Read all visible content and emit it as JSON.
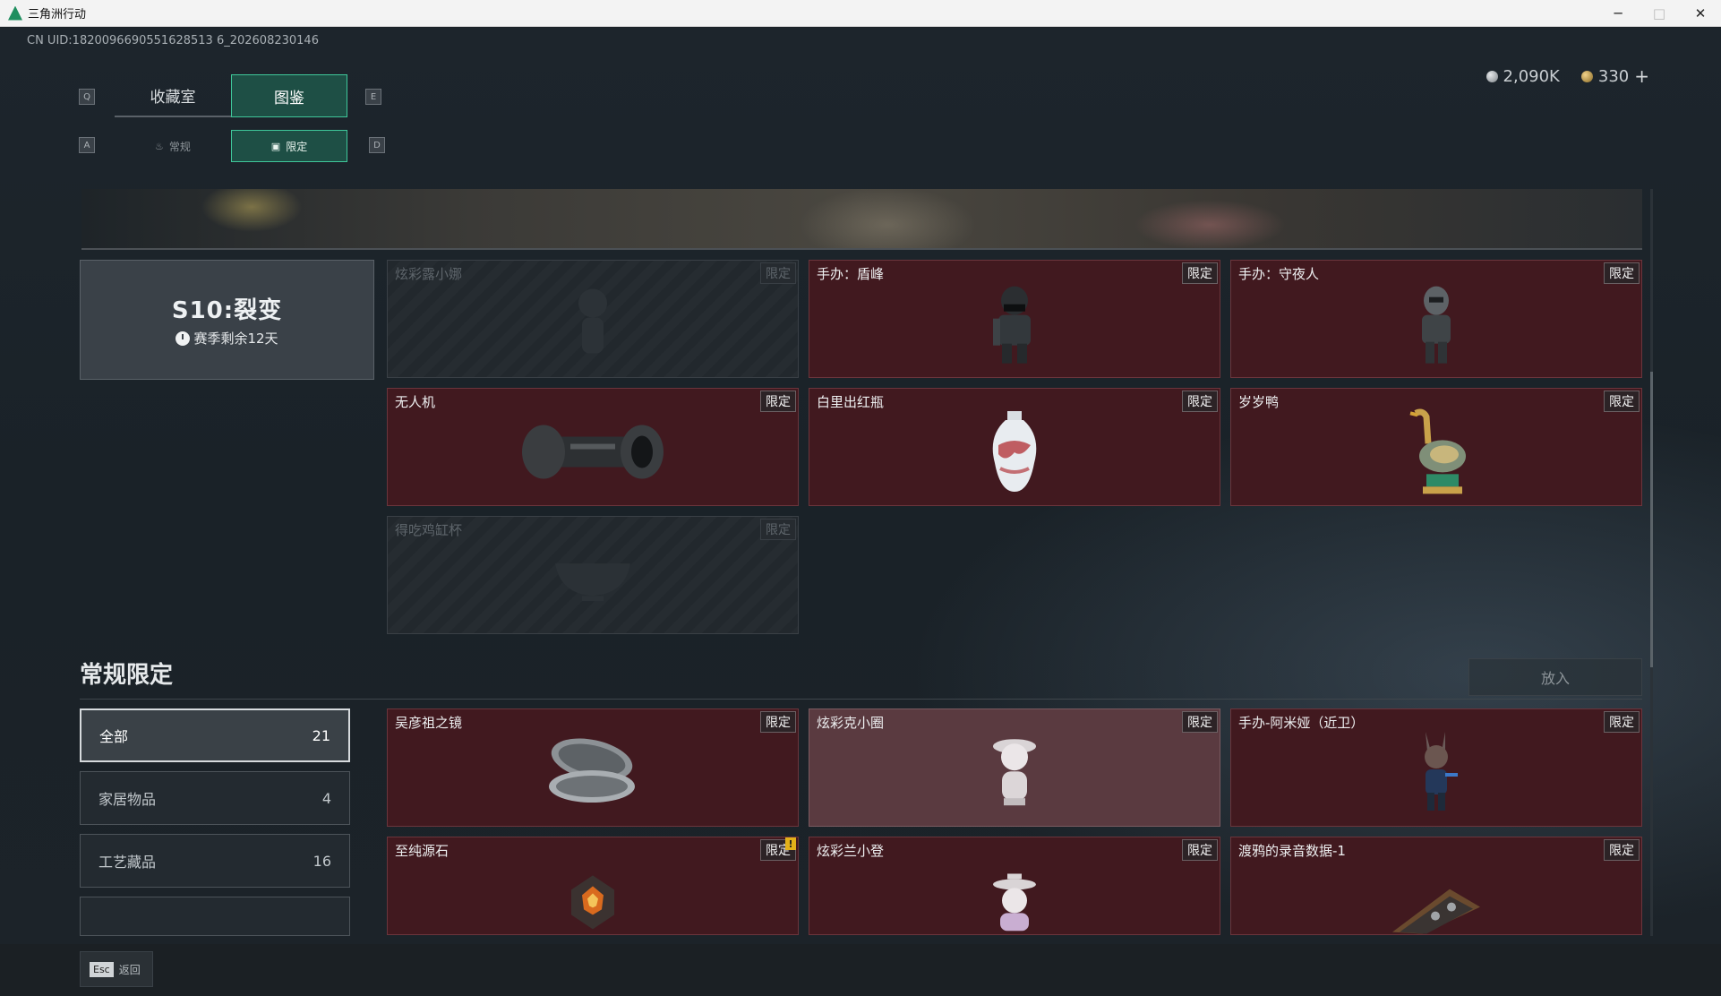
{
  "window": {
    "title": "三角洲行动",
    "controls": {
      "minimize": "─",
      "maximize": "□",
      "close": "✕"
    }
  },
  "uid": "CN UID:1820096690551628513 6_202608230146",
  "currency": [
    {
      "icon": "silver-coin-icon",
      "value": "2,090K"
    },
    {
      "icon": "gold-coin-icon",
      "value": "330"
    }
  ],
  "currency_plus": "+",
  "tabs": {
    "prev_key": "Q",
    "next_key": "E",
    "items": [
      {
        "label": "收藏室",
        "active": false
      },
      {
        "label": "图鉴",
        "active": true
      }
    ]
  },
  "subtabs": {
    "prev_key": "A",
    "next_key": "D",
    "items": [
      {
        "label": "常规",
        "icon": "flame-icon",
        "active": false
      },
      {
        "label": "限定",
        "icon": "image-icon",
        "active": true
      }
    ]
  },
  "season": {
    "title": "S10:裂变",
    "remaining": "赛季剩余12天"
  },
  "season_items": [
    {
      "name": "炫彩露小娜",
      "badge": "限定",
      "state": "locked",
      "icon": "figurine-icon"
    },
    {
      "name": "手办：盾峰",
      "badge": "限定",
      "state": "owned",
      "icon": "soldier-figure-icon"
    },
    {
      "name": "手办：守夜人",
      "badge": "限定",
      "state": "owned",
      "icon": "armored-figure-icon"
    },
    {
      "name": "无人机",
      "badge": "限定",
      "state": "owned",
      "icon": "drone-part-icon"
    },
    {
      "name": "白里出红瓶",
      "badge": "限定",
      "state": "owned",
      "icon": "vase-icon"
    },
    {
      "name": "岁岁鸭",
      "badge": "限定",
      "state": "owned",
      "icon": "duck-statue-icon"
    },
    {
      "name": "得吃鸡缸杯",
      "badge": "限定",
      "state": "locked",
      "icon": "bowl-icon"
    }
  ],
  "section": {
    "title": "常规限定",
    "put_button": "放入"
  },
  "filters": [
    {
      "label": "全部",
      "count": "21",
      "active": true
    },
    {
      "label": "家居物品",
      "count": "4",
      "active": false
    },
    {
      "label": "工艺藏品",
      "count": "16",
      "active": false
    }
  ],
  "regular_items": [
    {
      "name": "吴彦祖之镜",
      "badge": "限定",
      "state": "owned",
      "icon": "mirror-icon"
    },
    {
      "name": "炫彩克小圈",
      "badge": "限定",
      "state": "highlight",
      "icon": "figurine-icon"
    },
    {
      "name": "手办-阿米娅（近卫）",
      "badge": "限定",
      "state": "owned",
      "icon": "anime-figure-icon"
    },
    {
      "name": "至纯源石",
      "badge": "限定",
      "state": "owned",
      "icon": "crystal-icon",
      "warn": "!"
    },
    {
      "name": "炫彩兰小登",
      "badge": "限定",
      "state": "owned",
      "icon": "figurine-icon"
    },
    {
      "name": "渡鸦的录音数据-1",
      "badge": "限定",
      "state": "owned",
      "icon": "cassette-icon"
    }
  ],
  "footer": {
    "key": "Esc",
    "label": "返回"
  }
}
